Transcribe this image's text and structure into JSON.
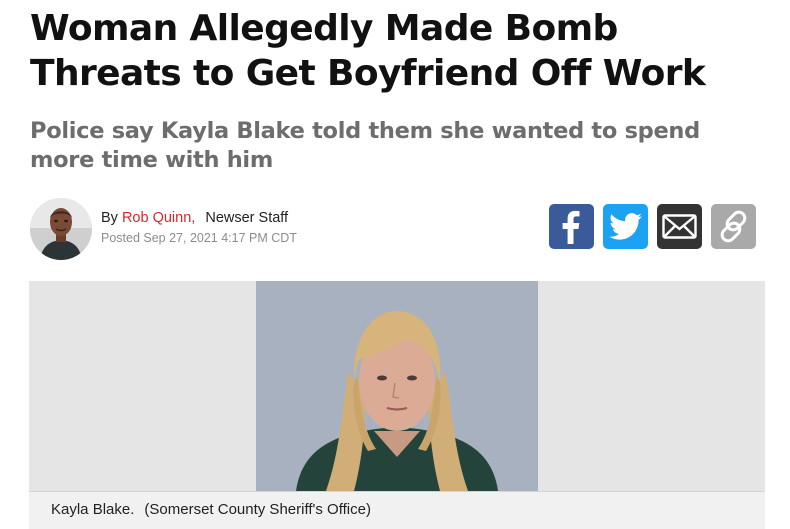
{
  "article": {
    "headline": "Woman Allegedly Made Bomb Threats to Get Boyfriend Off Work",
    "subhead": "Police say Kayla Blake told them she wanted to spend more time with him",
    "byline": {
      "prefix": "By",
      "author": "Rob Quinn,",
      "role": "Newser Staff",
      "posted": "Posted Sep 27, 2021 4:17 PM CDT"
    },
    "share": [
      {
        "name": "facebook",
        "icon": "facebook-icon",
        "color": "#3b5a9a"
      },
      {
        "name": "twitter",
        "icon": "twitter-icon",
        "color": "#1da1f2"
      },
      {
        "name": "email",
        "icon": "email-icon",
        "color": "#333333"
      },
      {
        "name": "link",
        "icon": "link-icon",
        "color": "#a9a9a9"
      }
    ],
    "image": {
      "caption": "Kayla Blake.",
      "credit": "(Somerset County Sheriff's Office)"
    }
  },
  "colors": {
    "author": "#d7282f",
    "subhead": "#6d6d6d",
    "photo_background": "#e5e5e5"
  }
}
